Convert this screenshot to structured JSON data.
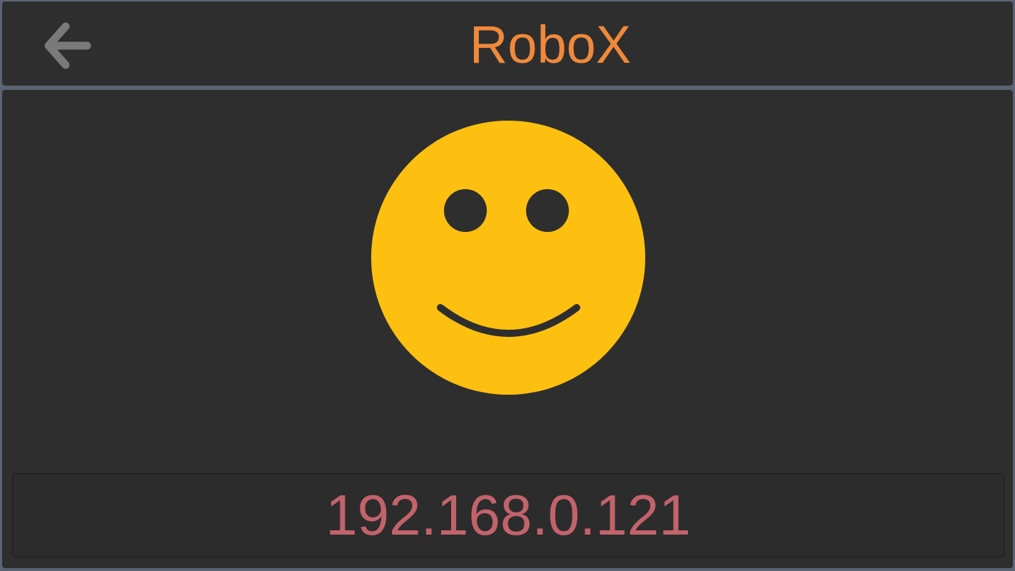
{
  "header": {
    "title": "RoboX",
    "back_icon": "arrow-left-icon"
  },
  "face": {
    "icon": "smiley-face-icon",
    "color": "#fdc011"
  },
  "status": {
    "ip_address": "192.168.0.121"
  },
  "colors": {
    "title": "#f0893a",
    "ip_text": "#c2636b",
    "panel_bg": "#2e2e2e",
    "back_icon": "#7a7a7a"
  }
}
